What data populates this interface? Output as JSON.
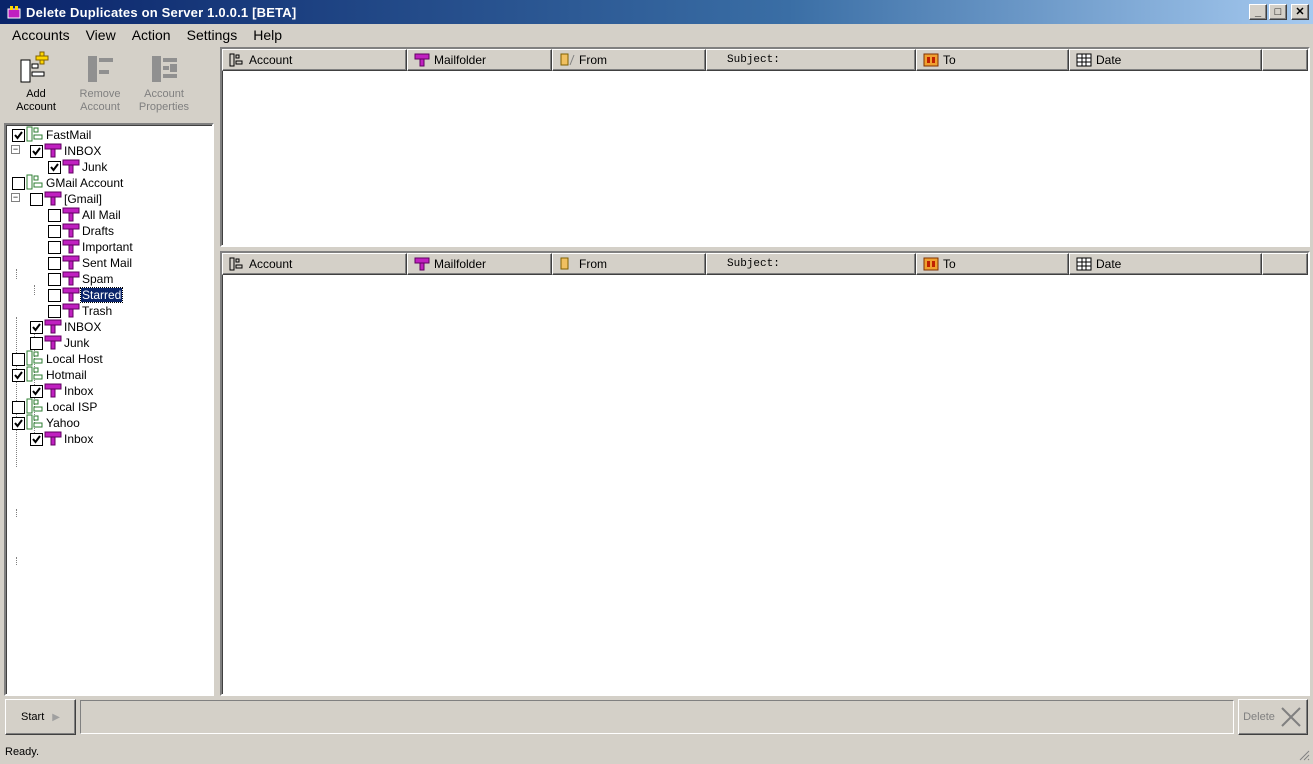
{
  "window": {
    "title": "Delete Duplicates on Server 1.0.0.1 [BETA]",
    "minimize": "_",
    "maximize": "□",
    "close": "✕"
  },
  "menu": [
    "Accounts",
    "View",
    "Action",
    "Settings",
    "Help"
  ],
  "toolbar": {
    "add_account": {
      "line1": "Add",
      "line2": "Account",
      "enabled": true
    },
    "remove_account": {
      "line1": "Remove",
      "line2": "Account",
      "enabled": false
    },
    "account_properties": {
      "line1": "Account",
      "line2": "Properties",
      "enabled": false
    }
  },
  "tree": [
    {
      "label": "FastMail",
      "type": "account",
      "checked": true
    },
    {
      "label": "INBOX",
      "type": "folder",
      "checked": true
    },
    {
      "label": "Junk",
      "type": "folder",
      "checked": true
    },
    {
      "label": "GMail Account",
      "type": "account",
      "checked": false
    },
    {
      "label": "[Gmail]",
      "type": "folder",
      "checked": false
    },
    {
      "label": "All Mail",
      "type": "folder",
      "checked": false
    },
    {
      "label": "Drafts",
      "type": "folder",
      "checked": false
    },
    {
      "label": "Important",
      "type": "folder",
      "checked": false
    },
    {
      "label": "Sent Mail",
      "type": "folder",
      "checked": false
    },
    {
      "label": "Spam",
      "type": "folder",
      "checked": false
    },
    {
      "label": "Starred",
      "type": "folder",
      "checked": false,
      "selected": true
    },
    {
      "label": "Trash",
      "type": "folder",
      "checked": false
    },
    {
      "label": "INBOX",
      "type": "folder",
      "checked": true
    },
    {
      "label": "Junk",
      "type": "folder",
      "checked": false
    },
    {
      "label": "Local Host",
      "type": "account",
      "checked": false
    },
    {
      "label": "Hotmail",
      "type": "account",
      "checked": true
    },
    {
      "label": "Inbox",
      "type": "folder",
      "checked": true
    },
    {
      "label": "Local ISP",
      "type": "account",
      "checked": false
    },
    {
      "label": "Yahoo",
      "type": "account",
      "checked": true
    },
    {
      "label": "Inbox",
      "type": "folder",
      "checked": true
    }
  ],
  "grid_top": {
    "columns": [
      "Account",
      "Mailfolder",
      "From",
      "Subject:",
      "To",
      "Date"
    ]
  },
  "grid_bottom": {
    "columns": [
      "Account",
      "Mailfolder",
      "From",
      "Subject:",
      "To",
      "Date"
    ]
  },
  "bottom": {
    "start_label": "Start",
    "delete_label": "Delete"
  },
  "status": {
    "text": "Ready."
  },
  "colors": {
    "titlebar_start": "#0a246a",
    "titlebar_end": "#a6caf0",
    "folder_icon": "#c020c0",
    "account_icon": "#2e7d32",
    "selection": "#0a246a"
  }
}
